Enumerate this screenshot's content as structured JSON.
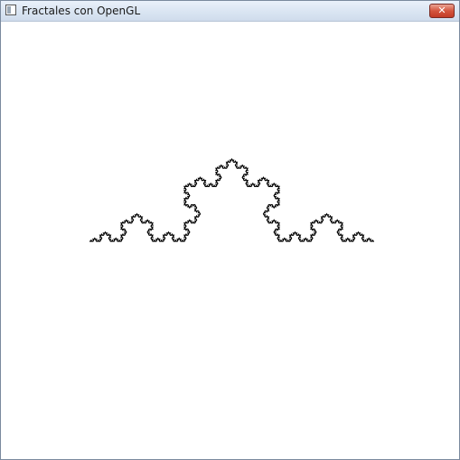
{
  "window": {
    "title": "Fractales con OpenGL",
    "close_glyph": "✕",
    "icon": "app-window-icon"
  },
  "canvas": {
    "background": "#ffffff",
    "stroke": "#000000",
    "fractal": "koch-curve",
    "iterations": 5
  }
}
